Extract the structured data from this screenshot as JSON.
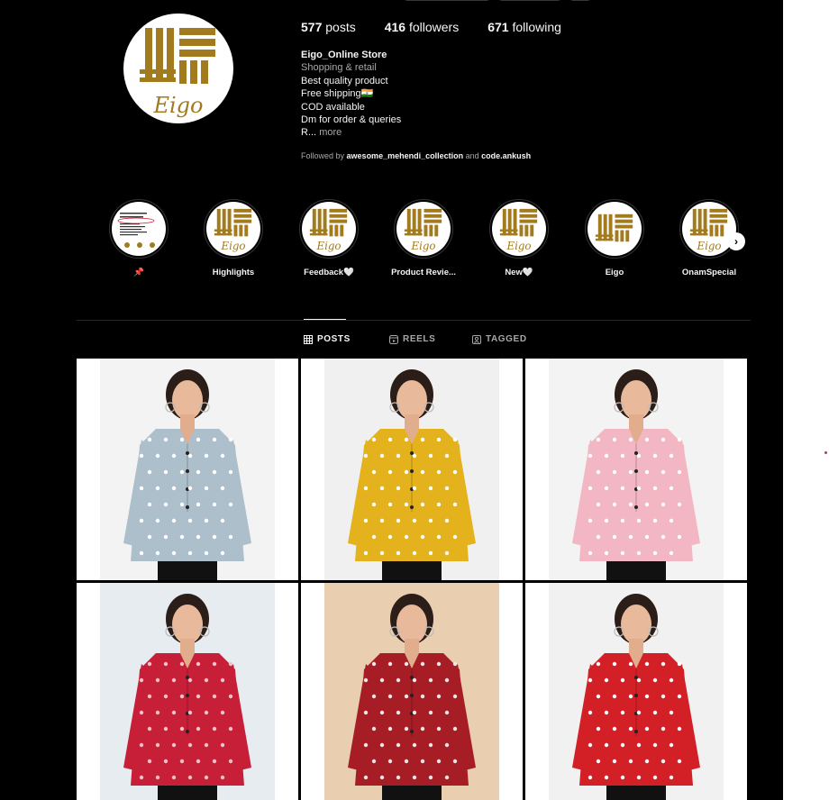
{
  "profile": {
    "stats": {
      "posts_count": "577",
      "posts_label": "posts",
      "followers_count": "416",
      "followers_label": "followers",
      "following_count": "671",
      "following_label": "following"
    },
    "bio": {
      "name": "Eigo_Online Store",
      "category": "Shopping & retail",
      "lines": [
        "Best quality product",
        "Free shipping🇮🇳",
        "COD available",
        "Dm for order & queries"
      ],
      "truncated": "R...",
      "more": "more"
    },
    "followed_by": {
      "prefix": "Followed by",
      "user1": "awesome_mehendi_collection",
      "and": "and",
      "user2": "code.ankush"
    },
    "logo_text": "Eigo"
  },
  "highlights": [
    {
      "label": "📌",
      "icon": "pin-icon"
    },
    {
      "label": "Highlights"
    },
    {
      "label": "Feedback🤍"
    },
    {
      "label": "Product Revie..."
    },
    {
      "label": "New🤍"
    },
    {
      "label": "Eigo"
    },
    {
      "label": "OnamSpecial"
    }
  ],
  "tabs": [
    {
      "label": "POSTS",
      "icon": "grid-icon",
      "active": true
    },
    {
      "label": "REELS",
      "icon": "reels-icon",
      "active": false
    },
    {
      "label": "TAGGED",
      "icon": "tagged-icon",
      "active": false
    }
  ],
  "colors": {
    "background": "#000000",
    "text_primary": "#f5f5f5",
    "text_secondary": "#a8a8a8",
    "logo_gold": "#a27b1f",
    "pin_red": "#e0245e"
  },
  "posts": [
    {
      "shirt": "#aebfcc",
      "dots": "#ffffff",
      "bg": "#f3f3f3",
      "multi": false
    },
    {
      "shirt": "#e4b21c",
      "dots": "#ffffff",
      "bg": "#f0f0f0",
      "multi": true
    },
    {
      "shirt": "#f2b7c3",
      "dots": "#ffffff",
      "bg": "#f3f3f3",
      "multi": false
    },
    {
      "shirt": "#c71f38",
      "dots": "#f4c2c7",
      "bg": "#e7ecf1",
      "multi": false
    },
    {
      "shirt": "#a61d25",
      "dots": "#f2e6e6",
      "bg": "#e9ceaf",
      "multi": false
    },
    {
      "shirt": "#d32027",
      "dots": "#ffffff",
      "bg": "#f1f1f1",
      "multi": false
    }
  ]
}
